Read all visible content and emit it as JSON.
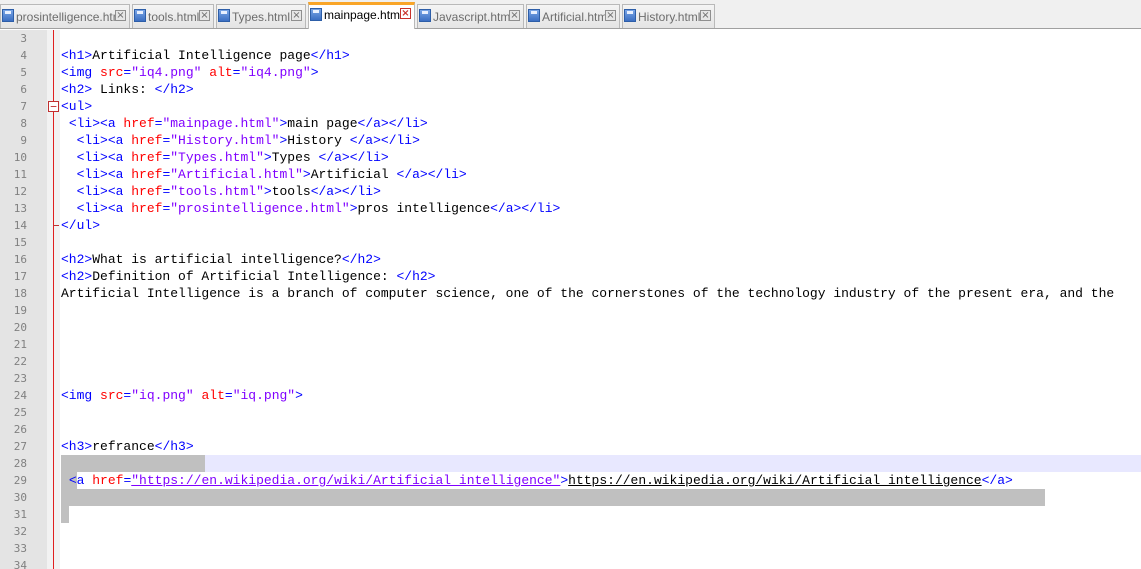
{
  "tabs": [
    {
      "label": "prosintelligence.html",
      "active": false
    },
    {
      "label": "tools.html",
      "active": false
    },
    {
      "label": "Types.html",
      "active": false
    },
    {
      "label": "mainpage.html",
      "active": true
    },
    {
      "label": "Javascript.html",
      "active": false
    },
    {
      "label": "Artificial.html",
      "active": false
    },
    {
      "label": "History.html",
      "active": false
    }
  ],
  "colors": {
    "tag": "#0000ff",
    "attribute": "#ff0000",
    "attribute_value": "#8000ff",
    "text": "#000000",
    "line_highlight": "#e8e8ff",
    "selection": "#c0c0c0",
    "active_tab_accent": "#f9a528",
    "fold_marker": "#c03030"
  },
  "icons": {
    "tab_file": "file-icon",
    "tab_close": "close-icon",
    "fold_open": "fold-minus-icon",
    "fold_end": "fold-end-icon"
  },
  "editor": {
    "lines": [
      {
        "n": "3",
        "tokens": []
      },
      {
        "n": "4",
        "tokens": [
          {
            "t": "<h1>",
            "c": "tag"
          },
          {
            "t": "Artificial Intelligence page",
            "c": "text"
          },
          {
            "t": "</h1>",
            "c": "tag"
          }
        ]
      },
      {
        "n": "5",
        "tokens": [
          {
            "t": "<img ",
            "c": "tag"
          },
          {
            "t": "src",
            "c": "attr"
          },
          {
            "t": "=",
            "c": "tag"
          },
          {
            "t": "\"iq4.png\"",
            "c": "val"
          },
          {
            "t": " ",
            "c": "text"
          },
          {
            "t": "alt",
            "c": "attr"
          },
          {
            "t": "=",
            "c": "tag"
          },
          {
            "t": "\"iq4.png\"",
            "c": "val"
          },
          {
            "t": ">",
            "c": "tag"
          }
        ]
      },
      {
        "n": "6",
        "tokens": [
          {
            "t": "<h2>",
            "c": "tag"
          },
          {
            "t": " Links: ",
            "c": "text"
          },
          {
            "t": "</h2>",
            "c": "tag"
          }
        ]
      },
      {
        "n": "7",
        "fold": "open",
        "tokens": [
          {
            "t": "<ul>",
            "c": "tag"
          }
        ]
      },
      {
        "n": "8",
        "tokens": [
          {
            "t": " ",
            "c": "text"
          },
          {
            "t": "<li><a ",
            "c": "tag"
          },
          {
            "t": "href",
            "c": "attr"
          },
          {
            "t": "=",
            "c": "tag"
          },
          {
            "t": "\"mainpage.html\"",
            "c": "val"
          },
          {
            "t": ">",
            "c": "tag"
          },
          {
            "t": "main page",
            "c": "text"
          },
          {
            "t": "</a></li>",
            "c": "tag"
          }
        ]
      },
      {
        "n": "9",
        "tokens": [
          {
            "t": "  ",
            "c": "text"
          },
          {
            "t": "<li><a ",
            "c": "tag"
          },
          {
            "t": "href",
            "c": "attr"
          },
          {
            "t": "=",
            "c": "tag"
          },
          {
            "t": "\"History.html\"",
            "c": "val"
          },
          {
            "t": ">",
            "c": "tag"
          },
          {
            "t": "History ",
            "c": "text"
          },
          {
            "t": "</a></li>",
            "c": "tag"
          }
        ]
      },
      {
        "n": "10",
        "tokens": [
          {
            "t": "  ",
            "c": "text"
          },
          {
            "t": "<li><a ",
            "c": "tag"
          },
          {
            "t": "href",
            "c": "attr"
          },
          {
            "t": "=",
            "c": "tag"
          },
          {
            "t": "\"Types.html\"",
            "c": "val"
          },
          {
            "t": ">",
            "c": "tag"
          },
          {
            "t": "Types ",
            "c": "text"
          },
          {
            "t": "</a></li>",
            "c": "tag"
          }
        ]
      },
      {
        "n": "11",
        "tokens": [
          {
            "t": "  ",
            "c": "text"
          },
          {
            "t": "<li><a ",
            "c": "tag"
          },
          {
            "t": "href",
            "c": "attr"
          },
          {
            "t": "=",
            "c": "tag"
          },
          {
            "t": "\"Artificial.html\"",
            "c": "val"
          },
          {
            "t": ">",
            "c": "tag"
          },
          {
            "t": "Artificial ",
            "c": "text"
          },
          {
            "t": "</a></li>",
            "c": "tag"
          }
        ]
      },
      {
        "n": "12",
        "tokens": [
          {
            "t": "  ",
            "c": "text"
          },
          {
            "t": "<li><a ",
            "c": "tag"
          },
          {
            "t": "href",
            "c": "attr"
          },
          {
            "t": "=",
            "c": "tag"
          },
          {
            "t": "\"tools.html\"",
            "c": "val"
          },
          {
            "t": ">",
            "c": "tag"
          },
          {
            "t": "tools",
            "c": "text"
          },
          {
            "t": "</a></li>",
            "c": "tag"
          }
        ]
      },
      {
        "n": "13",
        "tokens": [
          {
            "t": "  ",
            "c": "text"
          },
          {
            "t": "<li><a ",
            "c": "tag"
          },
          {
            "t": "href",
            "c": "attr"
          },
          {
            "t": "=",
            "c": "tag"
          },
          {
            "t": "\"prosintelligence.html\"",
            "c": "val"
          },
          {
            "t": ">",
            "c": "tag"
          },
          {
            "t": "pros intelligence",
            "c": "text"
          },
          {
            "t": "</a></li>",
            "c": "tag"
          }
        ]
      },
      {
        "n": "14",
        "fold": "end",
        "tokens": [
          {
            "t": "</ul>",
            "c": "tag"
          }
        ]
      },
      {
        "n": "15",
        "tokens": []
      },
      {
        "n": "16",
        "tokens": [
          {
            "t": "<h2>",
            "c": "tag"
          },
          {
            "t": "What is artificial intelligence?",
            "c": "text"
          },
          {
            "t": "</h2>",
            "c": "tag"
          }
        ]
      },
      {
        "n": "17",
        "tokens": [
          {
            "t": "<h2>",
            "c": "tag"
          },
          {
            "t": "Definition of Artificial Intelligence: ",
            "c": "text"
          },
          {
            "t": "</h2>",
            "c": "tag"
          }
        ]
      },
      {
        "n": "18",
        "tokens": [
          {
            "t": "Artificial Intelligence is a branch of computer science, one of the cornerstones of the technology industry of the present era, and the",
            "c": "text"
          }
        ]
      },
      {
        "n": "19",
        "tokens": []
      },
      {
        "n": "20",
        "tokens": []
      },
      {
        "n": "21",
        "tokens": []
      },
      {
        "n": "22",
        "tokens": []
      },
      {
        "n": "23",
        "tokens": []
      },
      {
        "n": "24",
        "tokens": [
          {
            "t": "<img ",
            "c": "tag"
          },
          {
            "t": "src",
            "c": "attr"
          },
          {
            "t": "=",
            "c": "tag"
          },
          {
            "t": "\"iq.png\"",
            "c": "val"
          },
          {
            "t": " ",
            "c": "text"
          },
          {
            "t": "alt",
            "c": "attr"
          },
          {
            "t": "=",
            "c": "tag"
          },
          {
            "t": "\"iq.png\"",
            "c": "val"
          },
          {
            "t": ">",
            "c": "tag"
          }
        ]
      },
      {
        "n": "25",
        "tokens": []
      },
      {
        "n": "26",
        "tokens": []
      },
      {
        "n": "27",
        "highlight": true,
        "tokens": [
          {
            "t": "<h3>",
            "c": "tag"
          },
          {
            "t": "refrance",
            "c": "text"
          },
          {
            "t": "</h3>",
            "c": "tag"
          }
        ]
      },
      {
        "n": "28",
        "tokens": []
      },
      {
        "n": "29",
        "tokens": [
          {
            "t": " ",
            "c": "text"
          },
          {
            "t": "<a ",
            "c": "tag"
          },
          {
            "t": "href",
            "c": "attr"
          },
          {
            "t": "=",
            "c": "tag"
          },
          {
            "t": "\"https://en.wikipedia.org/wiki/Artificial_intelligence\"",
            "c": "val",
            "u": true
          },
          {
            "t": ">",
            "c": "tag"
          },
          {
            "t": "https://en.wikipedia.org/wiki/Artificial_intelligence",
            "c": "text",
            "u": true
          },
          {
            "t": "</a>",
            "c": "tag"
          },
          {
            "t": " ",
            "c": "text"
          }
        ]
      },
      {
        "n": "30",
        "tokens": []
      },
      {
        "n": "31",
        "tokens": []
      },
      {
        "n": "32",
        "tokens": []
      },
      {
        "n": "33",
        "tokens": []
      },
      {
        "n": "34",
        "tokens": []
      }
    ]
  }
}
